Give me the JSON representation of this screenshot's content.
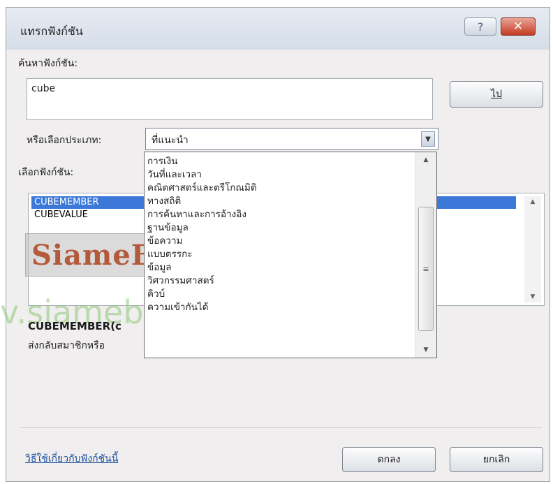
{
  "window": {
    "title": "แทรกฟังก์ชัน",
    "help_glyph": "?",
    "close_glyph": "✕"
  },
  "search": {
    "label": "ค้นหาฟังก์ชัน:",
    "value": "cube",
    "go_button": "ไป"
  },
  "category": {
    "label": "หรือเลือกประเภท:",
    "selected": "ที่แนะนำ",
    "options": [
      "การเงิน",
      "วันที่และเวลา",
      "คณิตศาสตร์และตรีโกณมิติ",
      "ทางสถิติ",
      "การค้นหาและการอ้างอิง",
      "ฐานข้อมูล",
      "ข้อความ",
      "แบบตรรกะ",
      "ข้อมูล",
      "วิศวกรรมศาสตร์",
      "คิวบ์",
      "ความเข้ากันได้"
    ]
  },
  "functions": {
    "label": "เลือกฟังก์ชัน:",
    "items": [
      "CUBEMEMBER",
      "CUBEVALUE"
    ],
    "selected_index": 0
  },
  "details": {
    "syntax": "CUBEMEMBER(c",
    "description": "ส่งกลับสมาชิกหรือ"
  },
  "watermark": {
    "logo_text": "SiameBook",
    "url_text": "v.siamebook.com"
  },
  "footer": {
    "help_link": "วิธีใช้เกี่ยวกับฟังก์ชันนี้",
    "ok_button": "ตกลง",
    "cancel_button": "ยกเลิก"
  },
  "colors": {
    "selection": "#3b78d8",
    "link": "#1a4f9d",
    "close": "#c43b24"
  }
}
